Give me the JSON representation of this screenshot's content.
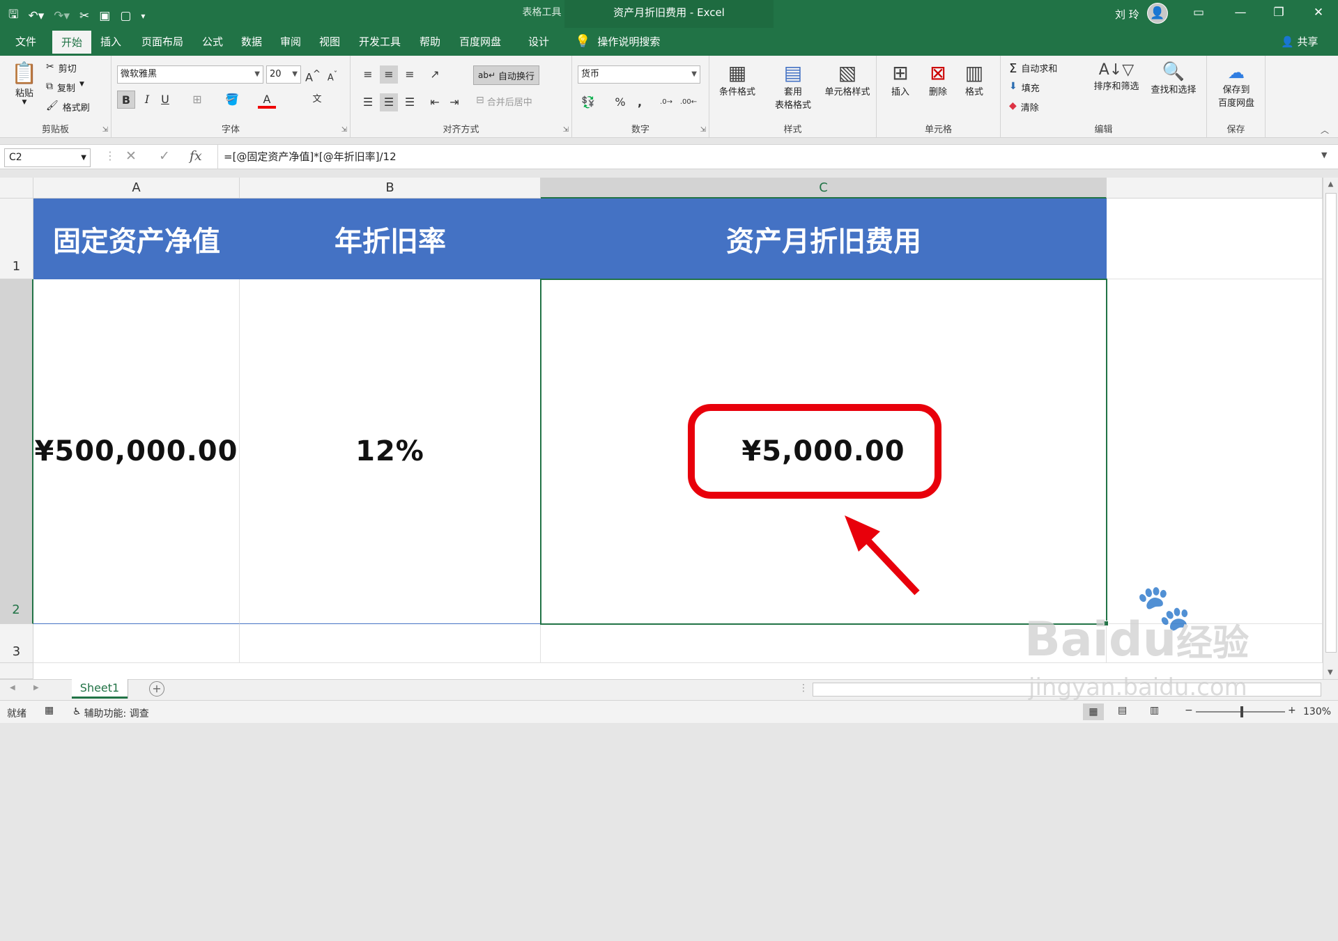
{
  "window": {
    "context_tab_group": "表格工具",
    "title": "资产月折旧费用 - Excel",
    "user_name": "刘 玲"
  },
  "tabs": [
    "文件",
    "开始",
    "插入",
    "页面布局",
    "公式",
    "数据",
    "审阅",
    "视图",
    "开发工具",
    "帮助",
    "百度网盘",
    "设计"
  ],
  "tell_me": "操作说明搜索",
  "share": "共享",
  "ribbon": {
    "clipboard": {
      "name": "剪贴板",
      "paste": "粘贴",
      "cut": "剪切",
      "copy": "复制",
      "format_painter": "格式刷"
    },
    "font": {
      "name": "字体",
      "font_name": "微软雅黑",
      "font_size": "20",
      "bold": "B",
      "italic": "I",
      "underline": "U"
    },
    "alignment": {
      "name": "对齐方式",
      "wrap_text": "自动换行",
      "merge_center": "合并后居中"
    },
    "number": {
      "name": "数字",
      "format": "货币",
      "percent": "%",
      "comma": ","
    },
    "styles": {
      "name": "样式",
      "conditional": "条件格式",
      "table_1": "套用",
      "table_2": "表格格式",
      "cell_styles": "单元格样式"
    },
    "cells": {
      "name": "单元格",
      "insert": "插入",
      "delete": "删除",
      "format": "格式"
    },
    "editing": {
      "name": "编辑",
      "autosum": "自动求和",
      "fill": "填充",
      "clear": "清除",
      "sort_filter": "排序和筛选",
      "find_select": "查找和选择"
    },
    "save": {
      "name": "保存",
      "save_1": "保存到",
      "save_2": "百度网盘"
    }
  },
  "formula_bar": {
    "name_box": "C2",
    "formula": "=[@固定资产净值]*[@年折旧率]/12"
  },
  "columns": [
    "A",
    "B",
    "C"
  ],
  "rows": [
    "1",
    "2",
    "3"
  ],
  "cells": {
    "A1": "固定资产净值",
    "B1": "年折旧率",
    "C1": "资产月折旧费用",
    "A2": "¥500,000.00",
    "B2": "12%",
    "C2": "¥5,000.00"
  },
  "sheet_tab": "Sheet1",
  "status": {
    "ready": "就绪",
    "accessibility": "辅助功能: 调查",
    "zoom": "130%"
  },
  "watermark": {
    "brand": "Bai",
    "brand2": "du",
    "brand_cn": "经验",
    "url": "jingyan.baidu.com"
  },
  "colors": {
    "excel_green": "#217346",
    "header_blue": "#4472c4",
    "highlight_red": "#e8000b"
  }
}
